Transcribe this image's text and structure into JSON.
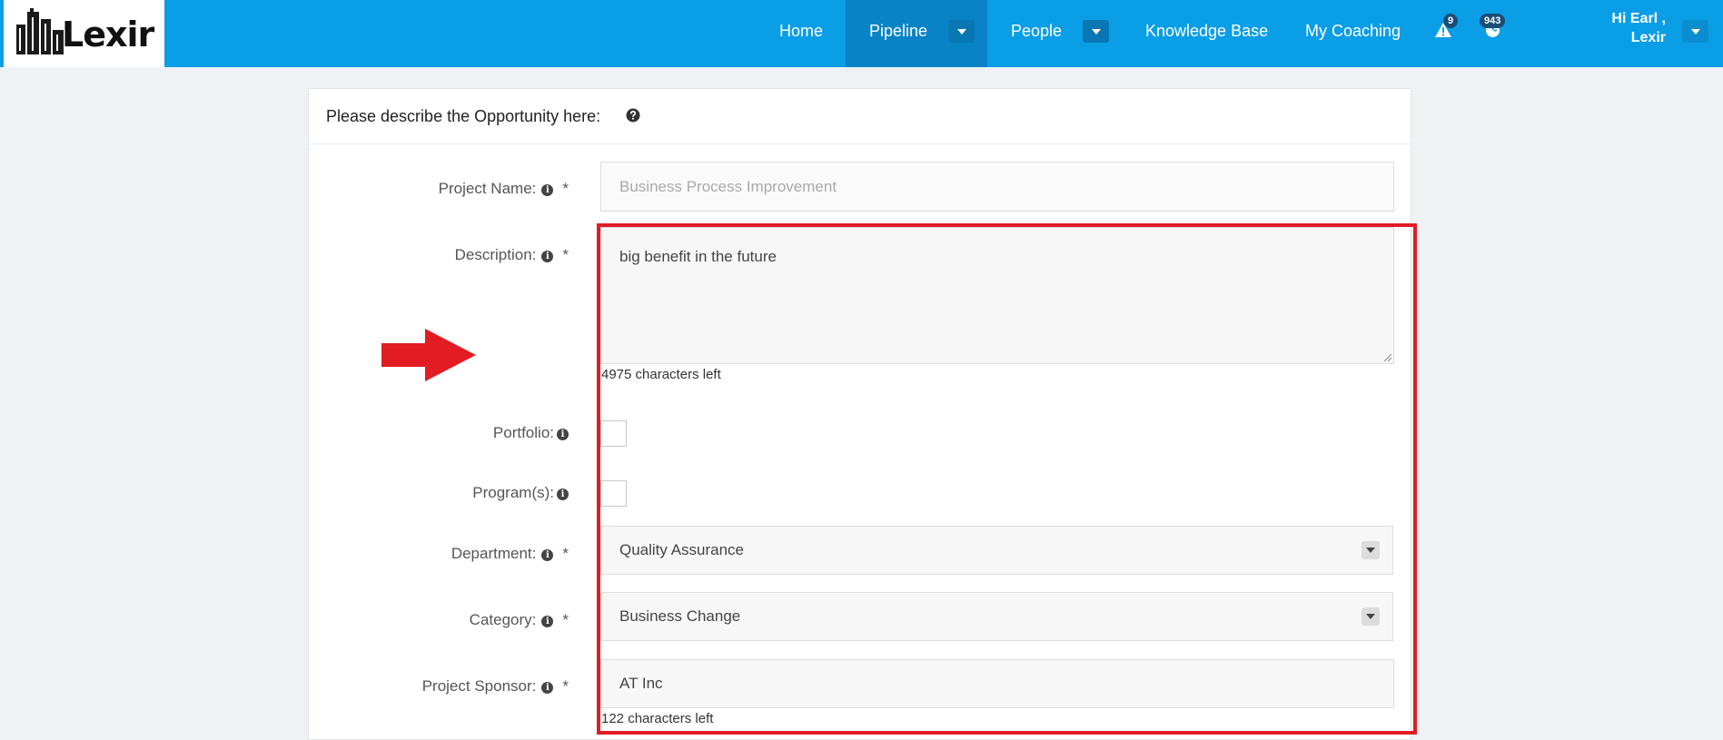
{
  "brand": {
    "name": "Lexir"
  },
  "nav": {
    "home": "Home",
    "pipeline": "Pipeline",
    "people": "People",
    "knowledge_base": "Knowledge Base",
    "my_coaching": "My Coaching",
    "alerts_count": "9",
    "notifications_count": "943",
    "user_greeting": "Hi Earl ,",
    "user_org": "Lexir"
  },
  "form": {
    "title": "Please describe the Opportunity here:",
    "project_name_label": "Project Name:",
    "project_name_value": "Business Process Improvement",
    "description_label": "Description:",
    "description_value": "big benefit in the future",
    "description_counter": "4975 characters left",
    "portfolio_label": "Portfolio:",
    "programs_label": "Program(s):",
    "department_label": "Department:",
    "department_value": "Quality Assurance",
    "category_label": "Category:",
    "category_value": "Business Change",
    "sponsor_label": "Project Sponsor:",
    "sponsor_value": "AT Inc",
    "sponsor_counter": "122 characters left",
    "required_mark": "*"
  },
  "colors": {
    "navbar": "#0a9ee6",
    "navbar_active": "#0884c6",
    "annotation": "#e31b23"
  },
  "icons": {
    "alerts": "warning-icon",
    "notifications": "globe-icon",
    "help": "question-circle-icon",
    "info": "info-circle-icon"
  }
}
